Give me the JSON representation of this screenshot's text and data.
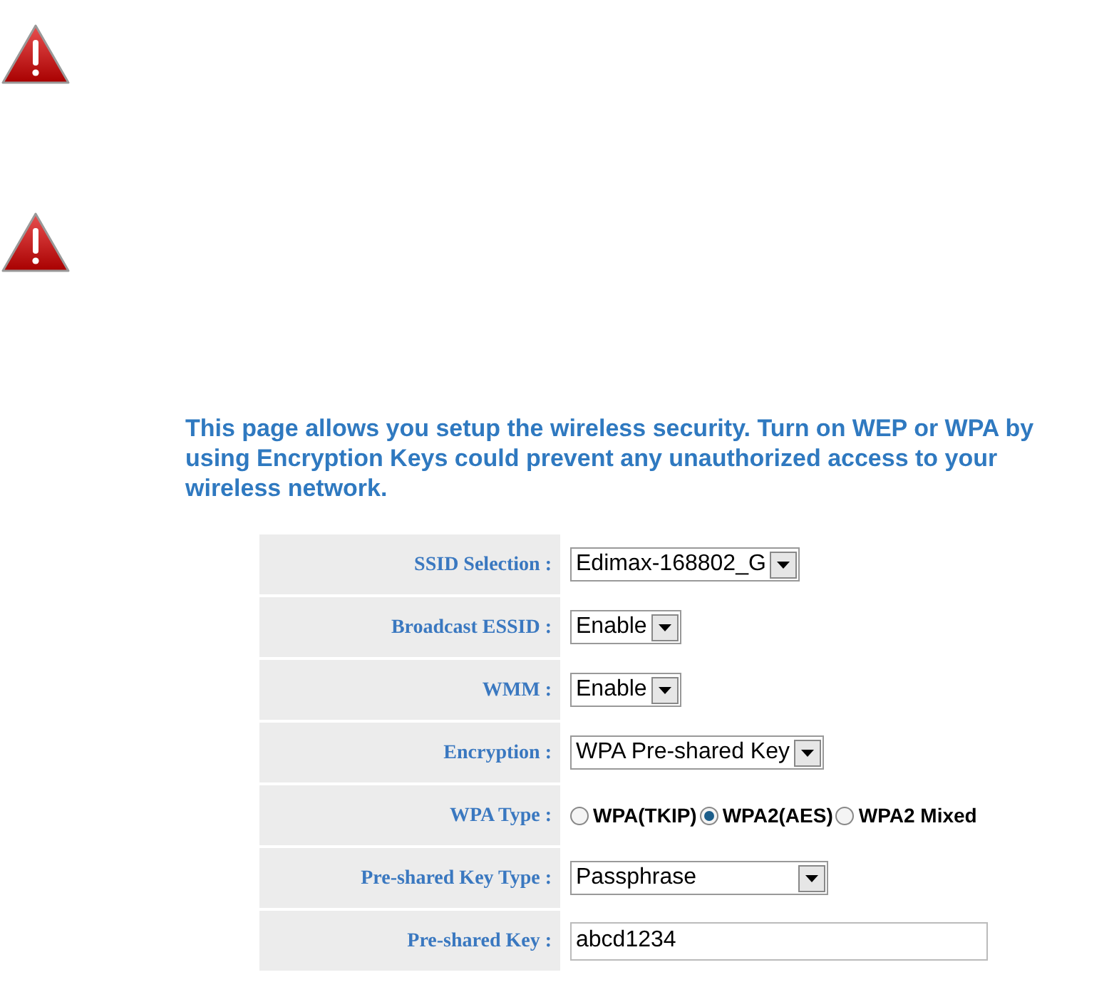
{
  "warnings": [
    {
      "kind": "warning"
    },
    {
      "kind": "warning"
    }
  ],
  "intro": "This page allows you setup the wireless security. Turn on WEP or WPA by using Encryption Keys could prevent any unauthorized access to your wireless network.",
  "rows": [
    {
      "label": "SSID Selection :",
      "kind": "select",
      "value": "Edimax-168802_G"
    },
    {
      "label": "Broadcast ESSID :",
      "kind": "select",
      "value": "Enable"
    },
    {
      "label": "WMM :",
      "kind": "select",
      "value": "Enable"
    },
    {
      "label": "Encryption :",
      "kind": "select",
      "value": "WPA Pre-shared Key"
    },
    {
      "label": "WPA Type :",
      "kind": "radio",
      "options": [
        {
          "label": "WPA(TKIP)",
          "selected": false
        },
        {
          "label": "WPA2(AES)",
          "selected": true
        },
        {
          "label": "WPA2 Mixed",
          "selected": false
        }
      ]
    },
    {
      "label": "Pre-shared Key Type :",
      "kind": "select",
      "value": "Passphrase",
      "wide": true
    },
    {
      "label": "Pre-shared Key :",
      "kind": "text",
      "value": "abcd1234"
    }
  ]
}
